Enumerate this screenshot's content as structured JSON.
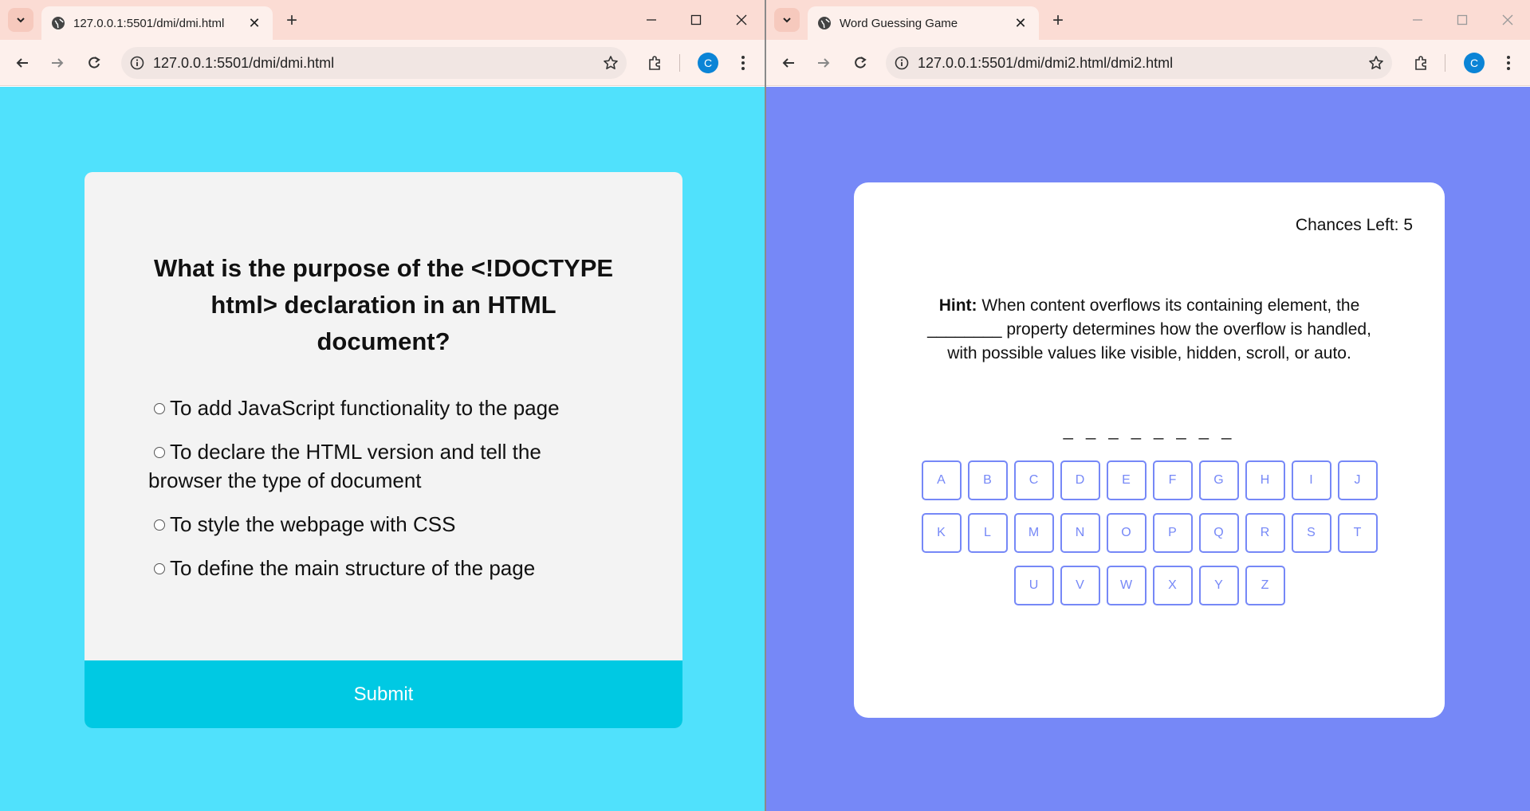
{
  "left_window": {
    "tab": {
      "title": "127.0.0.1:5501/dmi/dmi.html"
    },
    "toolbar": {
      "url": "127.0.0.1:5501/dmi/dmi.html",
      "profile_initial": "C"
    },
    "quiz": {
      "question": "What is the purpose of the <!DOCTYPE html> declaration in an HTML document?",
      "options": [
        {
          "label": "To add JavaScript functionality to the page"
        },
        {
          "label": "To declare the HTML version and tell the browser the type of document"
        },
        {
          "label": "To style the webpage with CSS"
        },
        {
          "label": "To define the main structure of the page"
        }
      ],
      "submit_label": "Submit"
    },
    "colors": {
      "background": "#50e1fc",
      "card": "#f3f3f3",
      "submit": "#00c9e3"
    }
  },
  "right_window": {
    "tab": {
      "title": "Word Guessing Game"
    },
    "toolbar": {
      "url": "127.0.0.1:5501/dmi/dmi2.html/dmi2.html",
      "profile_initial": "C"
    },
    "game": {
      "chances_label": "Chances Left: 5",
      "hint_prefix": "Hint:",
      "hint_text": "When content overflows its containing element, the ________ property determines how the overflow is handled, with possible values like visible, hidden, scroll, or auto.",
      "word_blanks": "_ _ _ _ _ _ _ _",
      "keyboard_rows": [
        [
          "A",
          "B",
          "C",
          "D",
          "E",
          "F",
          "G",
          "H",
          "I",
          "J"
        ],
        [
          "K",
          "L",
          "M",
          "N",
          "O",
          "P",
          "Q",
          "R",
          "S",
          "T"
        ],
        [
          "U",
          "V",
          "W",
          "X",
          "Y",
          "Z"
        ]
      ]
    },
    "colors": {
      "background": "#7688f7",
      "card": "#ffffff",
      "key_border": "#7688f7"
    }
  }
}
